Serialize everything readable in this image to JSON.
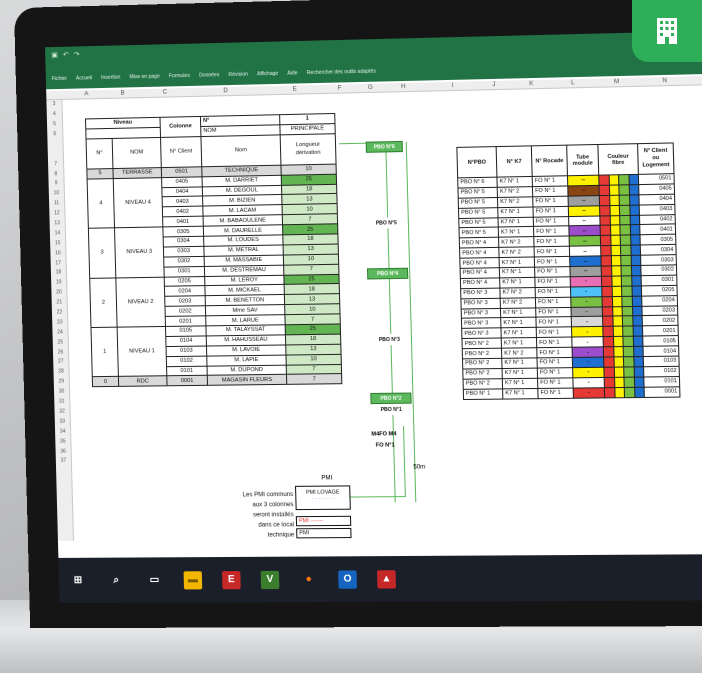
{
  "window": {
    "tabs": [
      "Fichier",
      "Accueil",
      "Insertion",
      "Mise en page",
      "Formules",
      "Données",
      "Révision",
      "Affichage",
      "Aide"
    ],
    "search_placeholder": "Rechercher des outils adaptés"
  },
  "columns": [
    "A",
    "B",
    "C",
    "D",
    "E",
    "F",
    "G",
    "H",
    "I",
    "J",
    "K",
    "L",
    "M",
    "N"
  ],
  "rows": [
    "3",
    "4",
    "5",
    "6",
    "7",
    "8",
    "9",
    "10",
    "11",
    "12",
    "13",
    "14",
    "15",
    "16",
    "17",
    "18",
    "19",
    "20",
    "21",
    "22",
    "23",
    "24",
    "25",
    "26",
    "27",
    "28",
    "29",
    "30",
    "31",
    "32",
    "33",
    "34",
    "35",
    "36",
    "37"
  ],
  "left_table": {
    "header": {
      "niveau": "Niveau",
      "colonne": "Colonne",
      "n_label": "N°",
      "n_value": "1",
      "nom_label": "NOM",
      "nom_value": "PRINCIPALE",
      "n_col": "N°",
      "nom_col": "NOM",
      "client_col": "N° Client",
      "nom2_col": "Nom",
      "longueur_col": "Longueur dérivation"
    },
    "rows": [
      {
        "n": "5",
        "level": "TERRASSE",
        "client": "0501",
        "name": "TECHNIQUE",
        "len": "10"
      },
      {
        "n": "4",
        "level": "NIVEAU 4",
        "client": "0405",
        "name": "M. DARRIET",
        "len": "25"
      },
      {
        "n": "",
        "level": "",
        "client": "0404",
        "name": "M. DEGOUL",
        "len": "18"
      },
      {
        "n": "",
        "level": "",
        "client": "0403",
        "name": "M. BIZIEN",
        "len": "13"
      },
      {
        "n": "",
        "level": "",
        "client": "0402",
        "name": "M. LACAM",
        "len": "10"
      },
      {
        "n": "",
        "level": "",
        "client": "0401",
        "name": "M. BABAOULENE",
        "len": "7"
      },
      {
        "n": "3",
        "level": "NIVEAU 3",
        "client": "0305",
        "name": "M. DAURELLE",
        "len": "25"
      },
      {
        "n": "",
        "level": "",
        "client": "0304",
        "name": "M. LOUDES",
        "len": "18"
      },
      {
        "n": "",
        "level": "",
        "client": "0303",
        "name": "M. METRAL",
        "len": "13"
      },
      {
        "n": "",
        "level": "",
        "client": "0302",
        "name": "M. MASSABIE",
        "len": "10"
      },
      {
        "n": "",
        "level": "",
        "client": "0301",
        "name": "M. DESTREMAU",
        "len": "7"
      },
      {
        "n": "2",
        "level": "NIVEAU 2",
        "client": "0205",
        "name": "M. LEROY",
        "len": "25"
      },
      {
        "n": "",
        "level": "",
        "client": "0204",
        "name": "M. MICKAEL",
        "len": "18"
      },
      {
        "n": "",
        "level": "",
        "client": "0203",
        "name": "M. BENETTON",
        "len": "13"
      },
      {
        "n": "",
        "level": "",
        "client": "0202",
        "name": "Mme SAV",
        "len": "10"
      },
      {
        "n": "",
        "level": "",
        "client": "0201",
        "name": "M. LARUE",
        "len": "7"
      },
      {
        "n": "1",
        "level": "NIVEAU 1",
        "client": "0105",
        "name": "M. TALAYSSAT",
        "len": "25"
      },
      {
        "n": "",
        "level": "",
        "client": "0104",
        "name": "M. HAHUSSEAU",
        "len": "18"
      },
      {
        "n": "",
        "level": "",
        "client": "0103",
        "name": "M. LAVOIE",
        "len": "13"
      },
      {
        "n": "",
        "level": "",
        "client": "0102",
        "name": "M. LAPIE",
        "len": "10"
      },
      {
        "n": "",
        "level": "",
        "client": "0101",
        "name": "M. DUPOND",
        "len": "7"
      },
      {
        "n": "0",
        "level": "RDC",
        "client": "0001",
        "name": "MAGASIN FLEURS",
        "len": "7"
      }
    ]
  },
  "pbo_tags": [
    "PBO N°6",
    "PBO N°5",
    "PBO N°4",
    "PBO N°3",
    "PBO N°2",
    "PBO N°1"
  ],
  "labels": {
    "m4fo": "M4FO M4",
    "fon1": "FO N°1",
    "dist": "50m",
    "pmi": "PMI",
    "pmi_lovage": "PMI LOVAGE",
    "pmi_a": "PMI -------",
    "pmi_b": "PMI",
    "note": [
      "Les PMI communs",
      "aux 3 colonnes",
      "seront installés",
      "dans ce local",
      "technique"
    ]
  },
  "right_table": {
    "headers": [
      "N°PBO",
      "N° K7",
      "N° Rocade",
      "Tube module",
      "Couleur fibre",
      "N° Client ou Logement"
    ],
    "rows": [
      {
        "pbo": "PBO N° 6",
        "k7": "K7 N° 1",
        "roc": "FO N° 1",
        "tube": "#fff200",
        "tube_mark": "--",
        "client": "0501"
      },
      {
        "pbo": "PBO N° 5",
        "k7": "K7 N° 2",
        "roc": "FO N° 1",
        "tube": "#8b4513",
        "tube_mark": "--",
        "client": "0405"
      },
      {
        "pbo": "PBO N° 5",
        "k7": "K7 N° 2",
        "roc": "FO N° 1",
        "tube": "#9e9e9e",
        "tube_mark": "--",
        "client": "0404"
      },
      {
        "pbo": "PBO N° 5",
        "k7": "K7 N° 1",
        "roc": "FO N° 1",
        "tube": "#fff200",
        "tube_mark": "--",
        "client": "0403"
      },
      {
        "pbo": "PBO N° 5",
        "k7": "K7 N° 1",
        "roc": "FO N° 1",
        "tube": "#ffffff",
        "tube_mark": "--",
        "client": "0402"
      },
      {
        "pbo": "PBO N° 5",
        "k7": "K7 N° 1",
        "roc": "FO N° 1",
        "tube": "#9c4dcc",
        "tube_mark": "--",
        "client": "0401"
      },
      {
        "pbo": "PBO N° 4",
        "k7": "K7 N° 2",
        "roc": "FO N° 1",
        "tube": "#7ac143",
        "tube_mark": "--",
        "client": "0305"
      },
      {
        "pbo": "PBO N° 4",
        "k7": "K7 N° 2",
        "roc": "FO N° 1",
        "tube": "#ffffff",
        "tube_mark": "--",
        "client": "0304"
      },
      {
        "pbo": "PBO N° 4",
        "k7": "K7 N° 1",
        "roc": "FO N° 1",
        "tube": "#1e6fd0",
        "tube_mark": "--",
        "client": "0303"
      },
      {
        "pbo": "PBO N° 4",
        "k7": "K7 N° 1",
        "roc": "FO N° 1",
        "tube": "#9e9e9e",
        "tube_mark": "--",
        "client": "0302"
      },
      {
        "pbo": "PBO N° 4",
        "k7": "K7 N° 1",
        "roc": "FO N° 1",
        "tube": "#e96fb4",
        "tube_mark": "-",
        "client": "0301"
      },
      {
        "pbo": "PBO N° 3",
        "k7": "K7 N° 2",
        "roc": "FO N° 1",
        "tube": "#4fc3f7",
        "tube_mark": "-",
        "client": "0205"
      },
      {
        "pbo": "PBO N° 3",
        "k7": "K7 N° 2",
        "roc": "FO N° 1",
        "tube": "#7ac143",
        "tube_mark": "-",
        "client": "0204"
      },
      {
        "pbo": "PBO N° 3",
        "k7": "K7 N° 1",
        "roc": "FO N° 1",
        "tube": "#9e9e9e",
        "tube_mark": "-",
        "client": "0203"
      },
      {
        "pbo": "PBO N° 3",
        "k7": "K7 N° 1",
        "roc": "FO N° 1",
        "tube": "#d9d9d9",
        "tube_mark": "-",
        "client": "0202"
      },
      {
        "pbo": "PBO N° 3",
        "k7": "K7 N° 1",
        "roc": "FO N° 1",
        "tube": "#fff200",
        "tube_mark": "-",
        "client": "0201"
      },
      {
        "pbo": "PBO N° 2",
        "k7": "K7 N° 1",
        "roc": "FO N° 1",
        "tube": "#ffffff",
        "tube_mark": "-",
        "client": "0105"
      },
      {
        "pbo": "PBO N° 2",
        "k7": "K7 N° 2",
        "roc": "FO N° 1",
        "tube": "#9c4dcc",
        "tube_mark": "-",
        "client": "0104"
      },
      {
        "pbo": "PBO N° 2",
        "k7": "K7 N° 1",
        "roc": "FO N° 1",
        "tube": "#1e6fd0",
        "tube_mark": "-",
        "client": "0103"
      },
      {
        "pbo": "PBO N° 2",
        "k7": "K7 N° 1",
        "roc": "FO N° 1",
        "tube": "#fff200",
        "tube_mark": "-",
        "client": "0102"
      },
      {
        "pbo": "PBO N° 2",
        "k7": "K7 N° 1",
        "roc": "FO N° 1",
        "tube": "#ffffff",
        "tube_mark": "-",
        "client": "0101"
      },
      {
        "pbo": "PBO N° 1",
        "k7": "K7 N° 1",
        "roc": "FO N° 1",
        "tube": "#e53935",
        "tube_mark": "-",
        "client": "0001"
      }
    ],
    "fiber_colors": [
      "#e53935",
      "#fff200",
      "#7ac143",
      "#1e6fd0"
    ]
  },
  "taskbar_icons": [
    "windows-icon",
    "search-icon",
    "cortana-icon",
    "file-explorer-icon",
    "excel-icon",
    "visio-icon",
    "firefox-icon",
    "outlook-icon",
    "pdf-icon"
  ],
  "colors": {
    "accent": "#2fae5a",
    "excel_green": "#217346"
  }
}
